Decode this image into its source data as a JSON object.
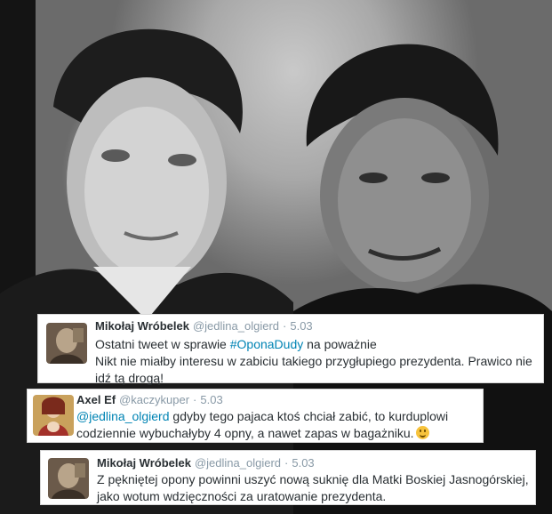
{
  "photo": {
    "alt": "photo-of-two-men"
  },
  "tweets": [
    {
      "author": "Mikołaj Wróbelek",
      "handle": "@jedlina_olgierd",
      "separator": "·",
      "date": "5.03",
      "line1_before": "Ostatni tweet w sprawie ",
      "line1_hashtag": "#OponaDudy",
      "line1_after": " na poważnie",
      "line2": "Nikt nie miałby interesu w zabiciu takiego przygłupiego prezydenta. Prawico nie idź tą drogą!",
      "avatar_icon": "avatar-icon"
    },
    {
      "author": "Axel Ef",
      "handle": "@kaczykuper",
      "separator": "·",
      "date": "5.03",
      "mention": "@jedlina_olgierd",
      "text": " gdyby tego pajaca ktoś chciał zabić, to kurduplowi codziennie wybuchałyby 4 opny, a nawet zapas w bagażniku.",
      "emoji_icon": "smiley-icon",
      "avatar_icon": "avatar-icon"
    },
    {
      "author": "Mikołaj Wróbelek",
      "handle": "@jedlina_olgierd",
      "separator": "·",
      "date": "5.03",
      "line1": "Z pękniętej opony powinni uszyć nową suknię dla Matki Boskiej Jasnogórskiej,",
      "line2": "jako wotum wdzięczności za uratowanie prezydenta.",
      "avatar_icon": "avatar-icon"
    }
  ],
  "colors": {
    "link": "#0084b4",
    "meta": "#8899a6",
    "text": "#292f33"
  }
}
